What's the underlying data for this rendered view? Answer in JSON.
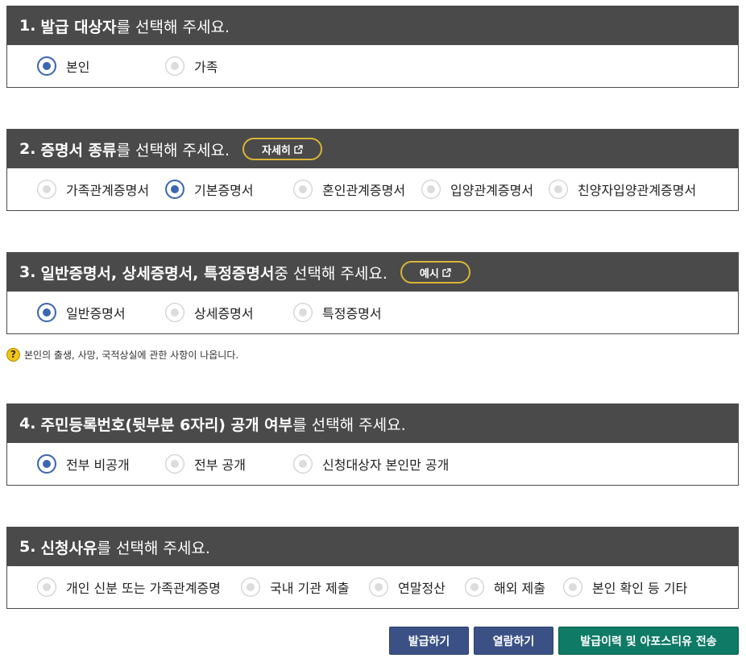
{
  "sections": [
    {
      "num": "1.",
      "title_bold": "발급 대상자",
      "title_rest": "를 선택해 주세요.",
      "options": [
        {
          "label": "본인",
          "selected": true
        },
        {
          "label": "가족",
          "selected": false
        }
      ]
    },
    {
      "num": "2.",
      "title_bold": "증명서 종류",
      "title_rest": "를 선택해 주세요.",
      "pill": "자세히",
      "options": [
        {
          "label": "가족관계증명서",
          "selected": false
        },
        {
          "label": "기본증명서",
          "selected": true
        },
        {
          "label": "혼인관계증명서",
          "selected": false
        },
        {
          "label": "입양관계증명서",
          "selected": false
        },
        {
          "label": "친양자입양관계증명서",
          "selected": false
        }
      ]
    },
    {
      "num": "3.",
      "title_bold": "일반증명서, 상세증명서, 특정증명서",
      "title_rest": " 중 선택해 주세요.",
      "pill": "예시",
      "options": [
        {
          "label": "일반증명서",
          "selected": true
        },
        {
          "label": "상세증명서",
          "selected": false
        },
        {
          "label": "특정증명서",
          "selected": false
        }
      ]
    },
    {
      "num": "4.",
      "title_bold": "주민등록번호(뒷부분 6자리) 공개 여부",
      "title_rest": "를 선택해 주세요.",
      "options": [
        {
          "label": "전부 비공개",
          "selected": true
        },
        {
          "label": "전부 공개",
          "selected": false
        },
        {
          "label": "신청대상자 본인만 공개",
          "selected": false
        }
      ]
    },
    {
      "num": "5.",
      "title_bold": "신청사유",
      "title_rest": "를 선택해 주세요.",
      "options": [
        {
          "label": "개인 신분 또는 가족관계증명",
          "selected": false
        },
        {
          "label": "국내 기관 제출",
          "selected": false
        },
        {
          "label": "연말정산",
          "selected": false
        },
        {
          "label": "해외 제출",
          "selected": false
        },
        {
          "label": "본인 확인 등 기타",
          "selected": false
        }
      ]
    }
  ],
  "hint": {
    "icon": "question-icon",
    "icon_glyph": "?",
    "text": "본인의 출생, 사망, 국적상실에 관한 사항이 나옵니다."
  },
  "buttons": {
    "issue": "발급하기",
    "view": "열람하기",
    "send": "발급이력 및 아포스티유 전송"
  },
  "colors": {
    "header_bg": "#4a4a4a",
    "radio_selected": "#3b66b0",
    "pill_border": "#d9b537",
    "btn_blue": "#3b5186",
    "btn_green": "#0f7a66"
  }
}
